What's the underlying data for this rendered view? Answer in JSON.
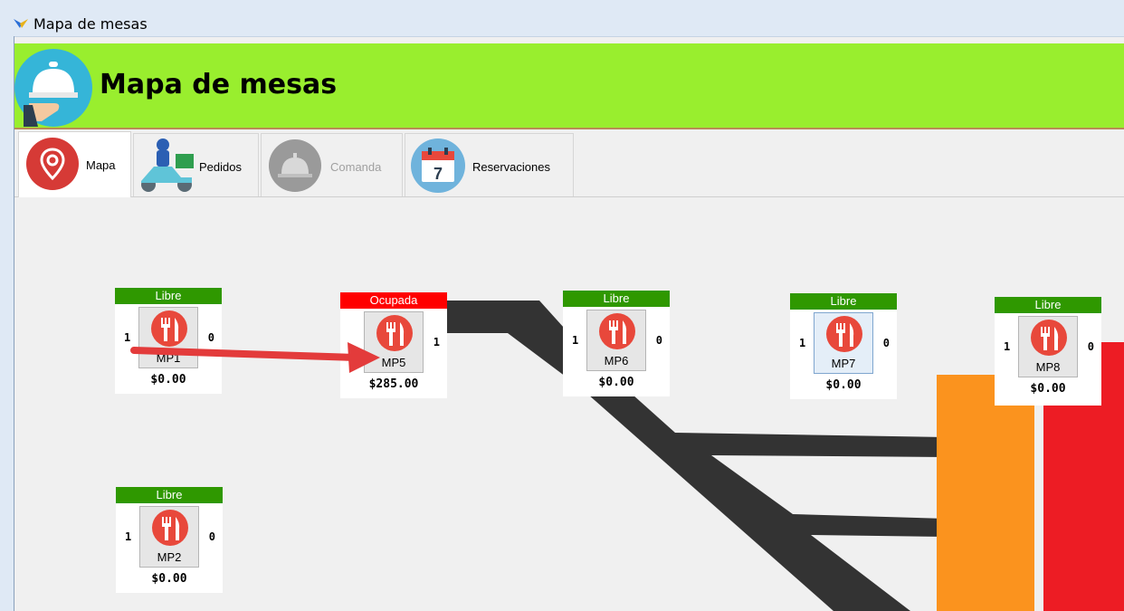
{
  "window": {
    "title": "Mapa de mesas"
  },
  "header": {
    "title": "Mapa de mesas"
  },
  "tabs": [
    {
      "label": "Mapa",
      "icon": "location-pin-icon",
      "active": true
    },
    {
      "label": "Pedidos",
      "icon": "delivery-scooter-icon"
    },
    {
      "label": "Comanda",
      "icon": "service-bell-icon",
      "disabled": true
    },
    {
      "label": "Reservaciones",
      "icon": "calendar-icon",
      "calendar_day": "7"
    }
  ],
  "tables": [
    {
      "name": "MP1",
      "status": "Libre",
      "left_count": "1",
      "right_count": "0",
      "total": "$0.00"
    },
    {
      "name": "MP5",
      "status": "Ocupada",
      "left_count": "",
      "right_count": "1",
      "total": "$285.00"
    },
    {
      "name": "MP6",
      "status": "Libre",
      "left_count": "1",
      "right_count": "0",
      "total": "$0.00"
    },
    {
      "name": "MP7",
      "status": "Libre",
      "left_count": "1",
      "right_count": "0",
      "total": "$0.00"
    },
    {
      "name": "MP8",
      "status": "Libre",
      "left_count": "1",
      "right_count": "0",
      "total": "$0.00"
    },
    {
      "name": "MP2",
      "status": "Libre",
      "left_count": "1",
      "right_count": "0",
      "total": "$0.00"
    }
  ],
  "colors": {
    "header_green": "#99ee2e",
    "status_libre": "#2f9800",
    "status_ocupada": "#ff0000",
    "cutlery_red": "#e8483b",
    "arrow_red": "#e33b3b",
    "floor_dark": "#333333",
    "wall_orange": "#fb931e",
    "wall_red": "#ed1c24"
  }
}
